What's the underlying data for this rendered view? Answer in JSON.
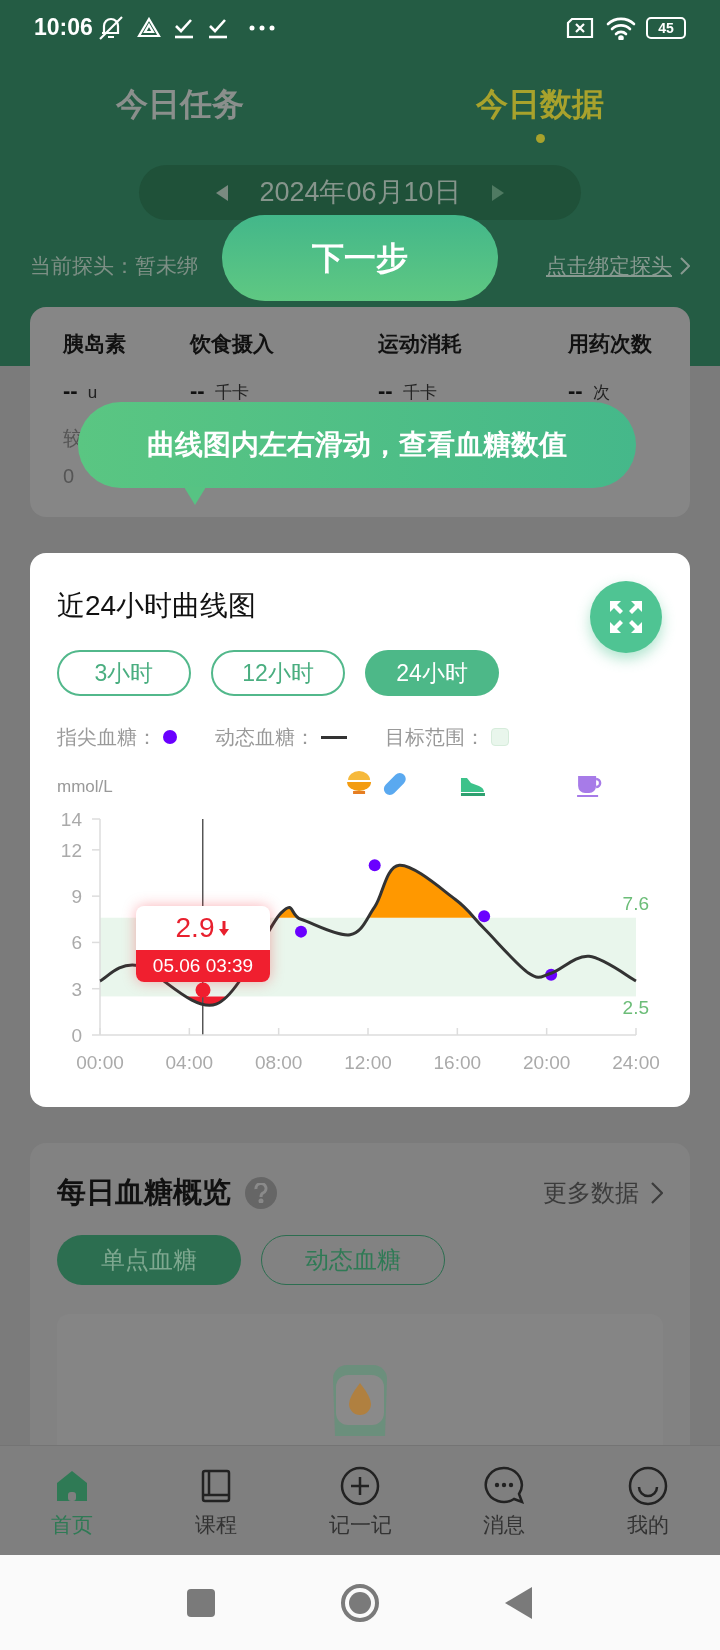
{
  "status_bar": {
    "time": "10:06",
    "battery": "45"
  },
  "tabs": [
    {
      "label": "今日任务",
      "selected": false
    },
    {
      "label": "今日数据",
      "selected": true
    }
  ],
  "date_picker": {
    "date": "2024年06月10日"
  },
  "probe": {
    "label": "当前探头：暂未绑",
    "link": "点击绑定探头"
  },
  "stats": {
    "items": [
      {
        "label": "胰岛素",
        "value": "--",
        "unit": "u"
      },
      {
        "label": "饮食摄入",
        "value": "--",
        "unit": "千卡"
      },
      {
        "label": "运动消耗",
        "value": "--",
        "unit": "千卡"
      },
      {
        "label": "用药次数",
        "value": "--",
        "unit": "次"
      }
    ],
    "comparison": {
      "label": "较",
      "value": "0"
    }
  },
  "guide": {
    "next_button": "下一步",
    "tip": "曲线图内左右滑动，查看血糖数值"
  },
  "curve_card": {
    "title": "近24小时曲线图",
    "ranges": [
      {
        "label": "3小时",
        "selected": false
      },
      {
        "label": "12小时",
        "selected": false
      },
      {
        "label": "24小时",
        "selected": true
      }
    ],
    "legend": [
      {
        "kind": "dot",
        "label": "指尖血糖："
      },
      {
        "kind": "line",
        "label": "动态血糖："
      },
      {
        "kind": "band",
        "label": "目标范围："
      }
    ],
    "target_range": {
      "high": "7.6",
      "low": "2.5"
    },
    "events": [
      {
        "kind": "meal"
      },
      {
        "kind": "pill"
      },
      {
        "kind": "exercise"
      },
      {
        "kind": "drink"
      }
    ],
    "tooltip": {
      "value": "2.9",
      "falling": true,
      "time": "05.06 03:39"
    },
    "chart_data": {
      "type": "line",
      "ylabel": "mmol/L",
      "x": [
        0,
        1.7,
        4.6,
        5.2,
        8.1,
        9,
        11.2,
        12.3,
        13.4,
        15.9,
        17.2,
        19.2,
        20.2,
        21.9,
        24
      ],
      "series": [
        {
          "color": "#333333",
          "values": [
            3.5,
            4.5,
            null,
            2.0,
            7.9,
            7.5,
            6.5,
            8.3,
            11.0,
            8.8,
            6.9,
            4.0,
            4.0,
            5.1,
            3.5
          ]
        },
        {
          "type": "scatter",
          "color": "#6a00ff",
          "values": [
            null,
            null,
            null,
            null,
            null,
            6.7,
            null,
            11.0,
            null,
            null,
            7.7,
            null,
            3.9,
            null,
            null
          ]
        }
      ],
      "xlim": [
        0,
        24
      ],
      "ylim": [
        0,
        14
      ],
      "xticks": [
        {
          "value": 0,
          "label": "00:00"
        },
        {
          "value": 4,
          "label": "04:00"
        },
        {
          "value": 8,
          "label": "08:00"
        },
        {
          "value": 12,
          "label": "12:00"
        },
        {
          "value": 16,
          "label": "16:00"
        },
        {
          "value": 20,
          "label": "20:00"
        },
        {
          "value": 24,
          "label": "24:00"
        }
      ],
      "yticks": [
        0,
        3,
        6,
        9,
        12,
        14
      ]
    }
  },
  "overview": {
    "title": "每日血糖概览",
    "more": "更多数据",
    "modes": [
      {
        "label": "单点血糖",
        "selected": true
      },
      {
        "label": "动态血糖",
        "selected": false
      }
    ]
  },
  "nav": [
    {
      "kind": "home",
      "label": "首页",
      "selected": true
    },
    {
      "kind": "course",
      "label": "课程",
      "selected": false
    },
    {
      "kind": "record",
      "label": "记一记",
      "selected": false
    },
    {
      "kind": "message",
      "label": "消息",
      "selected": false
    },
    {
      "kind": "me",
      "label": "我的",
      "selected": false
    }
  ]
}
